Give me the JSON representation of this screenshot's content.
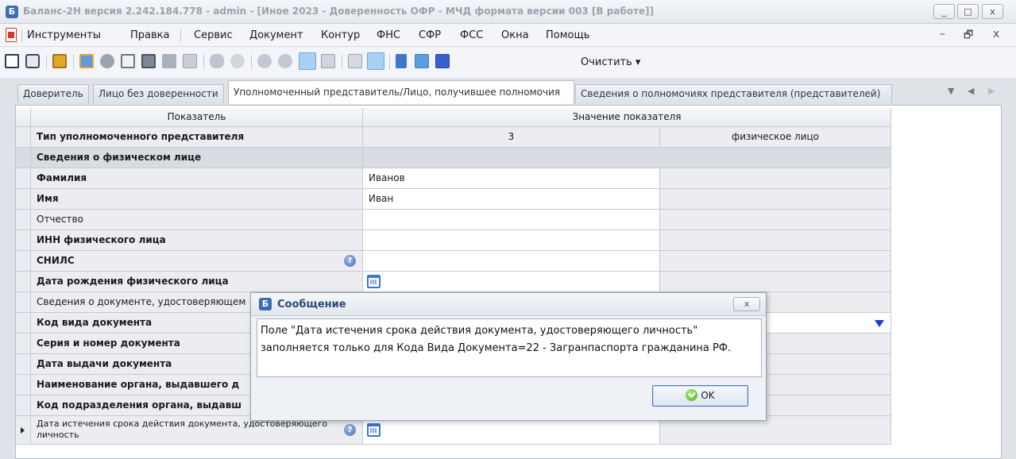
{
  "window": {
    "title": "Баланс-2Н версия 2.242.184.778 - admin - [Иное 2023 -  Доверенность ОФР - МЧД формата версии 003 [В работе]]",
    "app_icon_glyph": "Б",
    "minimize_glyph": "_",
    "maximize_glyph": "□",
    "close_glyph": "x"
  },
  "menu": {
    "items": [
      "Инструменты",
      "Правка",
      "Сервис",
      "Документ",
      "Контур",
      "ФНС",
      "СФР",
      "ФСС",
      "Окна",
      "Помощь"
    ],
    "mdi_minimize": "–",
    "mdi_restore": "🗗",
    "mdi_close": "x"
  },
  "toolbar": {
    "icons": [
      "save-icon",
      "print-icon",
      "clipboard-icon",
      "export-icon",
      "settings-icon",
      "calculator-icon",
      "table-icon",
      "text-icon",
      "copy-icon",
      "binoculars-icon",
      "filter-icon",
      "add-circle-icon",
      "remove-circle-icon",
      "layout-rows-icon",
      "layout-cols-icon",
      "grid-icon",
      "grid-selected-icon",
      "expand-icon",
      "chart-icon",
      "columns-icon"
    ],
    "clear_label": "Очистить ▾"
  },
  "tabs": {
    "items": [
      "Доверитель",
      "Лицо без доверенности",
      "Уполномоченный представитель/Лицо, получившее полномочия",
      "Сведения о полномочиях представителя (представителей)"
    ],
    "active_index": 2,
    "nav": [
      "▼",
      "◀",
      "▶"
    ]
  },
  "grid": {
    "header": {
      "indicator": "Показатель",
      "value": "Значение показателя"
    },
    "rows": [
      {
        "label": "Тип уполномоченного представителя",
        "bold": true,
        "value": "3",
        "extra": "физическое лицо"
      },
      {
        "label": "Сведения о физическом лице",
        "bold": true,
        "section": true
      },
      {
        "label": "Фамилия",
        "bold": true,
        "value": "Иванов"
      },
      {
        "label": "Имя",
        "bold": true,
        "value": "Иван"
      },
      {
        "label": "Отчество",
        "bold": false,
        "value": ""
      },
      {
        "label": "ИНН физического лица",
        "bold": true,
        "value": ""
      },
      {
        "label": "СНИЛС",
        "bold": true,
        "value": "",
        "help": true
      },
      {
        "label": "Дата рождения физического лица",
        "bold": true,
        "value": "",
        "calendar": true
      },
      {
        "label": "Сведения о документе, удостоверяющем",
        "bold": false,
        "value": ""
      },
      {
        "label": "Код вида документа",
        "bold": true,
        "value": "",
        "dropdown": true
      },
      {
        "label": "Серия и номер документа",
        "bold": true,
        "value": ""
      },
      {
        "label": "Дата выдачи документа",
        "bold": true,
        "value": ""
      },
      {
        "label": "Наименование органа, выдавшего д",
        "bold": true,
        "value": ""
      },
      {
        "label": "Код подразделения органа, выдавш",
        "bold": true,
        "value": ""
      },
      {
        "label": "Дата истечения срока действия документа, удостоверяющего личность",
        "bold": false,
        "value": "",
        "help": true,
        "calendar": true,
        "current": true
      }
    ]
  },
  "dialog": {
    "title": "Сообщение",
    "close_glyph": "x",
    "message_line1": "Поле \"Дата истечения срока действия документа, удостоверяющего личность\"",
    "message_line2": "заполняется только для Кода Вида Документа=22 - Загранпаспорта гражданина РФ.",
    "ok_label": "OK"
  },
  "colors": {
    "accent": "#3d77c9",
    "dropdown_arrow": "#1d3fd0",
    "dialog_title": "#2b4a7a"
  }
}
